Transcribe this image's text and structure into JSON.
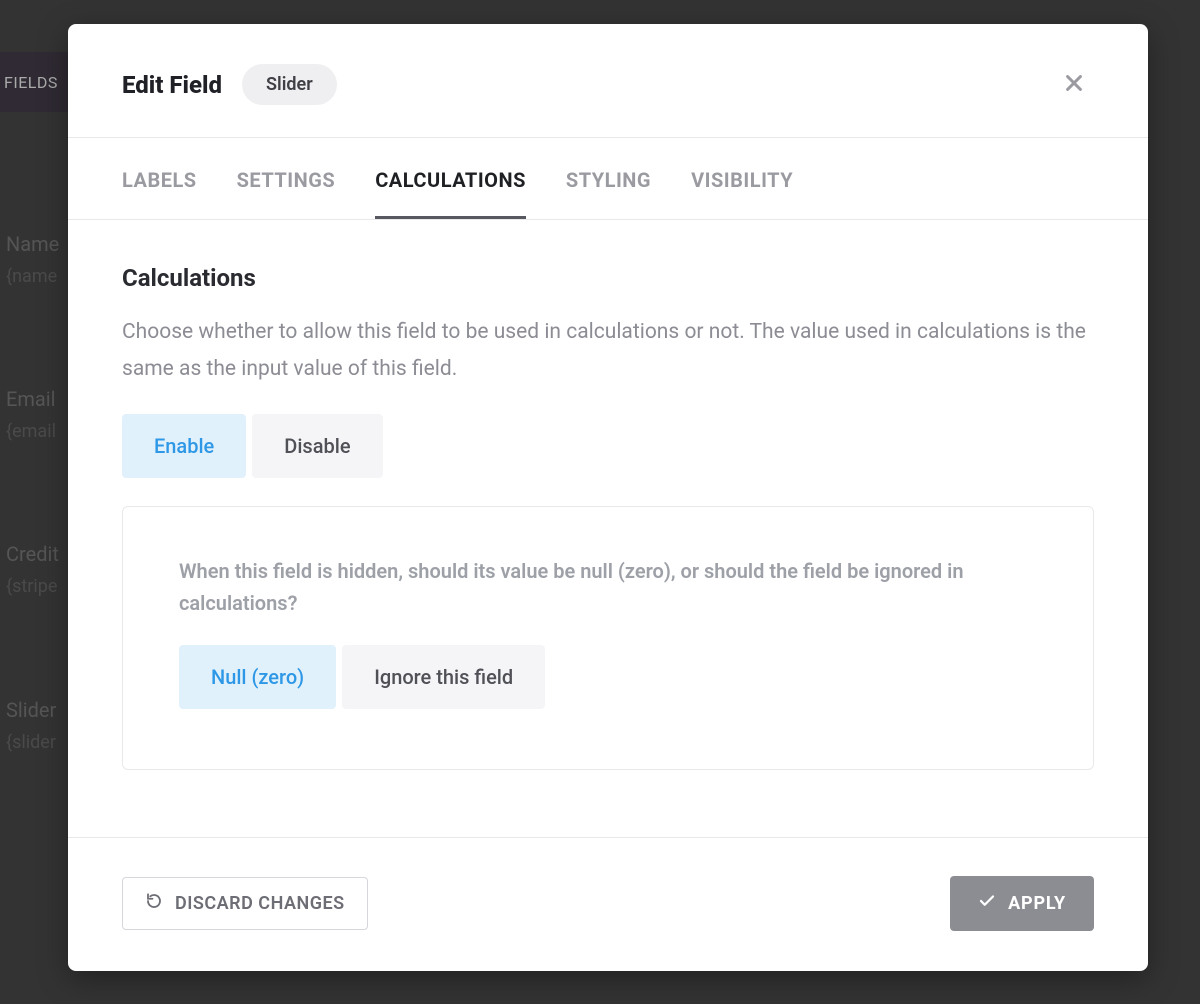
{
  "background": {
    "sidebar_tab": "FIELDS",
    "items": [
      {
        "label": "Name",
        "tag": "{name"
      },
      {
        "label": "Email",
        "tag": "{email"
      },
      {
        "label": "Credit",
        "tag": "{stripe"
      },
      {
        "label": "Slider",
        "tag": "{slider"
      }
    ]
  },
  "modal": {
    "title": "Edit Field",
    "chip": "Slider",
    "tabs": [
      {
        "label": "LABELS",
        "active": false
      },
      {
        "label": "SETTINGS",
        "active": false
      },
      {
        "label": "CALCULATIONS",
        "active": true
      },
      {
        "label": "STYLING",
        "active": false
      },
      {
        "label": "VISIBILITY",
        "active": false
      }
    ],
    "section": {
      "heading": "Calculations",
      "description": "Choose whether to allow this field to be used in calculations or not. The value used in calculations is the same as the input value of this field.",
      "toggle": {
        "enable": "Enable",
        "disable": "Disable",
        "selected": "enable"
      },
      "hidden_behavior": {
        "prompt": "When this field is hidden, should its value be null (zero), or should the field be ignored in calculations?",
        "null_label": "Null (zero)",
        "ignore_label": "Ignore this field",
        "selected": "null"
      }
    },
    "footer": {
      "discard": "DISCARD CHANGES",
      "apply": "APPLY"
    }
  }
}
